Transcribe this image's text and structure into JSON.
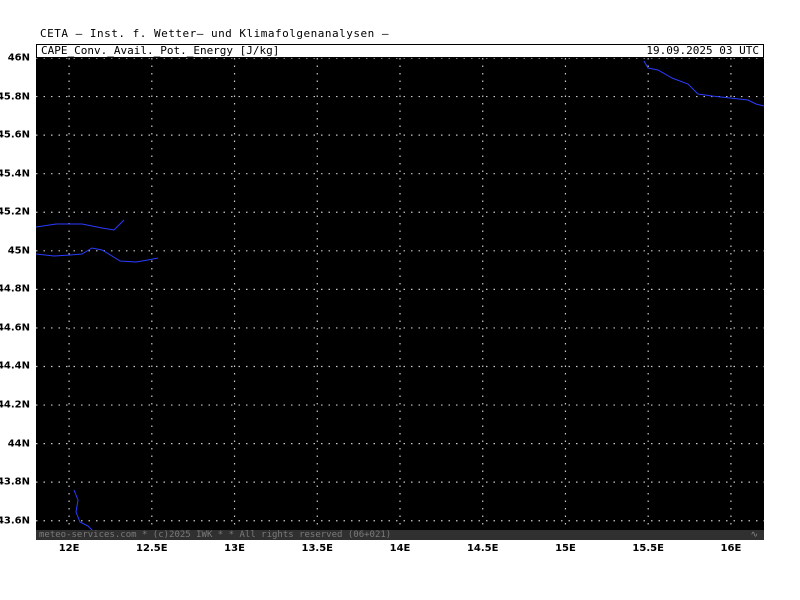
{
  "header": {
    "institute": "CETA — Inst. f. Wetter— und Klimafolgenanalysen —"
  },
  "titlebar": {
    "parameter": "CAPE_Conv._Avail._Pot._Energy [J/kg]",
    "valid_time": "19.09.2025 03 UTC"
  },
  "map": {
    "background_color": "#000000",
    "coastline_color": "#2a3cff",
    "grid_color": "#c8c8c8",
    "grid": true,
    "lon_range": [
      11.8,
      16.2
    ],
    "lat_range": [
      43.5,
      46.0
    ],
    "lon_ticks": [
      "12E",
      "12.5E",
      "13E",
      "13.5E",
      "14E",
      "14.5E",
      "15E",
      "15.5E",
      "16E"
    ],
    "lat_ticks": [
      "46N",
      "45.8N",
      "45.6N",
      "45.4N",
      "45.2N",
      "45N",
      "44.8N",
      "44.6N",
      "44.4N",
      "44.2N",
      "44N",
      "43.8N",
      "43.6N"
    ]
  },
  "footer": {
    "copyright": "meteo-services.com * (c)2025 IWK * * All rights reserved (06+021)",
    "mark": "∿"
  }
}
